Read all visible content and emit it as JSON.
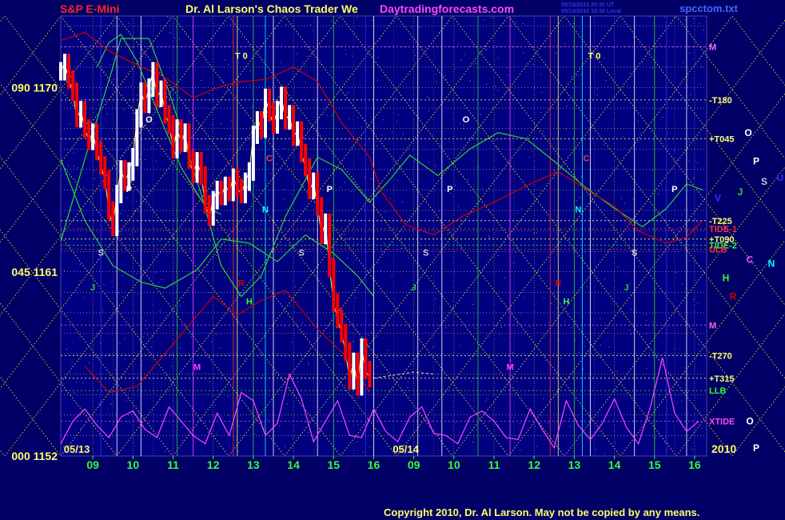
{
  "header": {
    "symbol": "S&P E-Mini",
    "title": "Dr. Al Larson's Chaos Trader We",
    "site": "Daytradingforecasts.com",
    "stamp_line1": "05/13/2010 20:30 UT",
    "stamp_line2": "05/13/2010 15:30 Local",
    "file": "spcctom.txt"
  },
  "footer": {
    "copyright": "Copyright 2010, Dr. Al Larson. May not be copied by any means.",
    "year": "2010"
  },
  "colors": {
    "background": "#000066",
    "grid_yellow": "#ffff66",
    "price_red": "#ff0000",
    "price_white": "#ffffff",
    "green_flux": "#33cc33",
    "red_flux": "#cc0000",
    "xtide": "#ff44ff",
    "fib_line": "#dddd22"
  },
  "chart_data": {
    "type": "line",
    "title": "S&P E-Mini",
    "xlabel": "",
    "ylabel": "",
    "ylim": [
      1152,
      1173.5
    ],
    "y_ticks": [
      {
        "value": 1170,
        "label": "090  1170"
      },
      {
        "value": 1161,
        "label": "045  1161"
      },
      {
        "value": 1152,
        "label": "000  1152"
      }
    ],
    "day_labels": [
      "05/13",
      "05/14"
    ],
    "hour_ticks": [
      "09",
      "10",
      "11",
      "12",
      "13",
      "14",
      "15",
      "16",
      "09",
      "10",
      "11",
      "12",
      "13",
      "14",
      "15",
      "16"
    ],
    "x_range": [
      8.2,
      24.3
    ],
    "price": {
      "name": "S&P E-Mini",
      "x": [
        8.2,
        8.3,
        8.4,
        8.5,
        8.6,
        8.7,
        8.8,
        8.9,
        9.0,
        9.1,
        9.2,
        9.3,
        9.4,
        9.5,
        9.6,
        9.7,
        9.8,
        9.9,
        10.0,
        10.1,
        10.2,
        10.3,
        10.4,
        10.5,
        10.6,
        10.7,
        10.8,
        10.9,
        11.0,
        11.1,
        11.2,
        11.3,
        11.4,
        11.5,
        11.6,
        11.7,
        11.8,
        11.9,
        12.0,
        12.1,
        12.2,
        12.3,
        12.4,
        12.5,
        12.6,
        12.7,
        12.8,
        12.9,
        13.0,
        13.1,
        13.2,
        13.3,
        13.4,
        13.5,
        13.6,
        13.7,
        13.8,
        13.9,
        14.0,
        14.1,
        14.2,
        14.3,
        14.4,
        14.5,
        14.6,
        14.7,
        14.8,
        14.9,
        15.0,
        15.1,
        15.2,
        15.3,
        15.4,
        15.5,
        15.6,
        15.7,
        15.8,
        15.9
      ],
      "close": [
        1170.8,
        1171.2,
        1170.4,
        1169.8,
        1168.5,
        1168.9,
        1168.0,
        1167.4,
        1167.8,
        1166.9,
        1166.2,
        1165.5,
        1164.0,
        1163.2,
        1164.8,
        1166.0,
        1165.4,
        1165.9,
        1166.6,
        1168.5,
        1169.8,
        1169.2,
        1170.0,
        1170.8,
        1169.5,
        1169.9,
        1168.7,
        1168.2,
        1167.0,
        1168.0,
        1167.3,
        1167.8,
        1166.5,
        1165.8,
        1166.4,
        1165.7,
        1164.3,
        1163.7,
        1164.5,
        1165.0,
        1164.7,
        1165.2,
        1164.9,
        1165.6,
        1165.1,
        1164.8,
        1165.4,
        1165.9,
        1167.7,
        1168.4,
        1168.0,
        1169.5,
        1168.8,
        1168.2,
        1168.9,
        1169.6,
        1168.4,
        1168.7,
        1167.6,
        1167.9,
        1166.8,
        1166.1,
        1165.0,
        1165.4,
        1164.2,
        1162.8,
        1163.4,
        1161.2,
        1159.5,
        1158.7,
        1158.0,
        1157.1,
        1155.7,
        1156.6,
        1155.4,
        1157.3,
        1156.2,
        1155.8
      ],
      "extension_x": [
        16.0,
        17.0,
        17.5
      ],
      "extension_close": [
        1155.8,
        1156.1,
        1156.0
      ]
    },
    "bands": [
      {
        "color": "green",
        "x": [
          8.2,
          8.8,
          9.5,
          9.7,
          10.4,
          10.9,
          11.7,
          12.2,
          12.7,
          13.2,
          13.8,
          14.6,
          15.2,
          15.9,
          16.4,
          16.9,
          17.6,
          18.4,
          19.1,
          19.8,
          20.5,
          21.3,
          22.0,
          22.7,
          23.3,
          23.8,
          24.2
        ],
        "values": [
          1162.5,
          1166.5,
          1171.0,
          1172.4,
          1172.4,
          1169.8,
          1164.8,
          1161.3,
          1159.8,
          1160.8,
          1163.7,
          1166.6,
          1166.0,
          1164.4,
          1165.5,
          1166.7,
          1165.7,
          1167.0,
          1167.8,
          1167.5,
          1166.4,
          1165.1,
          1164.1,
          1163.2,
          1164.1,
          1165.3,
          1165.0
        ]
      },
      {
        "color": "green",
        "x": [
          8.2,
          8.8,
          9.5,
          10.2,
          10.8,
          11.6,
          12.2,
          12.9,
          13.6,
          14.3,
          15.0,
          15.6,
          16.0
        ],
        "values": [
          1166.5,
          1163.5,
          1161.3,
          1160.5,
          1160.2,
          1161.1,
          1162.6,
          1162.4,
          1161.5,
          1162.8,
          1161.9,
          1160.8,
          1159.8
        ]
      },
      {
        "color": "green",
        "x": [
          9.1,
          9.4,
          9.7,
          10.1,
          10.6,
          11.2,
          11.8,
          12.2
        ],
        "values": [
          1171.0,
          1172.2,
          1172.6,
          1171.3,
          1168.9,
          1166.1,
          1164.2,
          1163.8
        ]
      },
      {
        "color": "red",
        "x": [
          8.2,
          8.8,
          9.4,
          10.0,
          10.8,
          11.5,
          12.1,
          12.7,
          13.3,
          14.0,
          14.6,
          15.2,
          15.9,
          16.2,
          16.8,
          17.5,
          18.2,
          19.0,
          19.8,
          20.6,
          21.4,
          22.0,
          22.6,
          23.3,
          23.8,
          24.2
        ],
        "values": [
          1172.3,
          1172.7,
          1171.8,
          1171.2,
          1170.5,
          1169.5,
          1170.0,
          1170.3,
          1170.4,
          1171.0,
          1170.3,
          1168.3,
          1166.6,
          1164.9,
          1163.3,
          1162.8,
          1163.7,
          1164.4,
          1165.2,
          1165.9,
          1164.9,
          1164.2,
          1163.0,
          1162.4,
          1162.7,
          1163.5
        ]
      },
      {
        "color": "red",
        "x": [
          8.8,
          9.4,
          10.1,
          10.8,
          11.4,
          12.0,
          12.6,
          13.2,
          13.8,
          14.6,
          15.3,
          15.9
        ],
        "values": [
          1156.4,
          1155.1,
          1155.4,
          1157.0,
          1158.4,
          1159.8,
          1158.9,
          1159.6,
          1160.1,
          1158.2,
          1156.9,
          1155.1
        ]
      }
    ],
    "xtide": {
      "name": "XTIDE",
      "x": [
        8.2,
        8.5,
        8.8,
        9.1,
        9.4,
        9.7,
        10.0,
        10.3,
        10.6,
        10.9,
        11.2,
        11.5,
        11.8,
        12.1,
        12.4,
        12.7,
        13.0,
        13.3,
        13.6,
        13.9,
        14.2,
        14.5,
        14.8,
        15.1,
        15.4,
        15.7,
        16.0,
        16.3,
        16.6,
        16.9,
        17.2,
        17.5,
        17.8,
        18.1,
        18.4,
        18.7,
        19.0,
        19.3,
        19.6,
        19.9,
        20.2,
        20.5,
        20.8,
        21.1,
        21.4,
        21.7,
        22.0,
        22.3,
        22.6,
        22.9,
        23.2,
        23.5,
        23.8,
        24.1
      ],
      "values": [
        1152.6,
        1153.7,
        1154.3,
        1153.5,
        1152.9,
        1153.9,
        1154.2,
        1153.3,
        1152.9,
        1154.4,
        1153.7,
        1153.0,
        1152.6,
        1154.1,
        1153.0,
        1155.1,
        1154.7,
        1153.0,
        1153.6,
        1156.0,
        1154.8,
        1152.7,
        1153.7,
        1154.7,
        1153.0,
        1152.9,
        1154.3,
        1153.2,
        1152.7,
        1153.9,
        1154.4,
        1153.1,
        1153.0,
        1152.6,
        1153.9,
        1154.2,
        1153.7,
        1152.9,
        1152.8,
        1154.3,
        1153.3,
        1152.4,
        1154.7,
        1153.5,
        1152.8,
        1153.6,
        1154.8,
        1153.4,
        1152.6,
        1154.4,
        1156.8,
        1154.1,
        1153.2,
        1153.7
      ]
    },
    "horizontal_levels": [
      {
        "label": "M",
        "value": 1172.0,
        "color": "#ff66ff"
      },
      {
        "label": "-T180",
        "value": 1169.4,
        "color": "#ffff66"
      },
      {
        "label": "+T045",
        "value": 1167.5,
        "color": "#ffff66"
      },
      {
        "label": "-T225",
        "value": 1163.5,
        "color": "#ffff66"
      },
      {
        "label": "+T090",
        "value": 1162.6,
        "color": "#ffff66"
      },
      {
        "label": "TIDE-1",
        "value": 1163.1,
        "color": "#ff3333"
      },
      {
        "label": "TIDE-2",
        "value": 1162.3,
        "color": "#33ff33"
      },
      {
        "label": "ULB",
        "value": 1162.1,
        "color": "#ff3333"
      },
      {
        "label": "M",
        "value": 1158.4,
        "color": "#ff66ff"
      },
      {
        "label": "-T270",
        "value": 1156.9,
        "color": "#ffff66"
      },
      {
        "label": "+T315",
        "value": 1155.8,
        "color": "#ffff66"
      },
      {
        "label": "LLB",
        "value": 1155.2,
        "color": "#33ff33"
      },
      {
        "label": "XTIDE",
        "value": 1153.7,
        "color": "#ff44ff"
      }
    ],
    "planet_labels": [
      {
        "label": "O",
        "color": "#ffffff",
        "value": 1167.8
      },
      {
        "label": "P",
        "color": "#ffffff",
        "value": 1166.4
      },
      {
        "label": "U",
        "color": "#3333ff",
        "value": 1165.6
      },
      {
        "label": "J",
        "color": "#33cc33",
        "value": 1164.9
      },
      {
        "label": "S",
        "color": "#cccccc",
        "value": 1165.4
      },
      {
        "label": "V",
        "color": "#3333ff",
        "value": 1164.6
      },
      {
        "label": "C",
        "color": "#ff44ff",
        "value": 1161.6
      },
      {
        "label": "N",
        "color": "#00ffff",
        "value": 1161.4
      },
      {
        "label": "H",
        "color": "#33ff33",
        "value": 1160.7
      },
      {
        "label": "R",
        "color": "#cc0000",
        "value": 1159.8
      },
      {
        "label": "O",
        "color": "#ffffff",
        "value": 1153.7
      },
      {
        "label": "P",
        "color": "#ffffff",
        "value": 1152.4
      }
    ],
    "event_labels": [
      {
        "label": "T 0",
        "color": "#ffff66",
        "x": 12.7,
        "value": 1171.4
      },
      {
        "label": "T 0",
        "color": "#ffff66",
        "x": 21.5,
        "value": 1171.4
      },
      {
        "label": "O",
        "color": "#ffffff",
        "x": 10.4,
        "value": 1168.3
      },
      {
        "label": "O",
        "color": "#ffffff",
        "x": 18.3,
        "value": 1168.3
      },
      {
        "label": "P",
        "color": "#ffffff",
        "x": 9.9,
        "value": 1164.9
      },
      {
        "label": "P",
        "color": "#ffffff",
        "x": 14.9,
        "value": 1164.9
      },
      {
        "label": "P",
        "color": "#ffffff",
        "x": 17.9,
        "value": 1164.9
      },
      {
        "label": "P",
        "color": "#ffffff",
        "x": 23.5,
        "value": 1164.9
      },
      {
        "label": "C",
        "color": "#ff3333",
        "x": 13.4,
        "value": 1166.4
      },
      {
        "label": "C",
        "color": "#ff3333",
        "x": 21.3,
        "value": 1166.4
      },
      {
        "label": "N",
        "color": "#00ffff",
        "x": 13.3,
        "value": 1163.9
      },
      {
        "label": "N",
        "color": "#00ffff",
        "x": 21.1,
        "value": 1163.9
      },
      {
        "label": "S",
        "color": "#cccccc",
        "x": 9.2,
        "value": 1161.8
      },
      {
        "label": "S",
        "color": "#cccccc",
        "x": 14.2,
        "value": 1161.8
      },
      {
        "label": "S",
        "color": "#cccccc",
        "x": 17.3,
        "value": 1161.8
      },
      {
        "label": "S",
        "color": "#cccccc",
        "x": 22.5,
        "value": 1161.8
      },
      {
        "label": "J",
        "color": "#33cc33",
        "x": 9.0,
        "value": 1160.1
      },
      {
        "label": "J",
        "color": "#33cc33",
        "x": 17.0,
        "value": 1160.1
      },
      {
        "label": "J",
        "color": "#33cc33",
        "x": 22.3,
        "value": 1160.1
      },
      {
        "label": "H",
        "color": "#33ff33",
        "x": 12.9,
        "value": 1159.4
      },
      {
        "label": "H",
        "color": "#33ff33",
        "x": 20.8,
        "value": 1159.4
      },
      {
        "label": "R",
        "color": "#cc0000",
        "x": 12.7,
        "value": 1160.3
      },
      {
        "label": "R",
        "color": "#cc0000",
        "x": 20.6,
        "value": 1160.3
      },
      {
        "label": "M",
        "color": "#ff44ff",
        "x": 11.6,
        "value": 1156.2
      },
      {
        "label": "M",
        "color": "#ff44ff",
        "x": 19.4,
        "value": 1156.2
      }
    ],
    "vertical_events": [
      {
        "x": 9.2,
        "color": "#3333ff"
      },
      {
        "x": 9.6,
        "color": "#ffffff"
      },
      {
        "x": 10.2,
        "color": "#ffffff"
      },
      {
        "x": 11.1,
        "color": "#33cc33"
      },
      {
        "x": 11.5,
        "color": "#ff44ff"
      },
      {
        "x": 12.5,
        "color": "#ff3333"
      },
      {
        "x": 12.6,
        "color": "#ffff66"
      },
      {
        "x": 13.0,
        "color": "#33cc33"
      },
      {
        "x": 13.3,
        "color": "#00ffff"
      },
      {
        "x": 13.5,
        "color": "#ffffff"
      },
      {
        "x": 14.6,
        "color": "#ffffff"
      },
      {
        "x": 15.0,
        "color": "#33cc33"
      },
      {
        "x": 15.8,
        "color": "#3333ff"
      },
      {
        "x": 16.0,
        "color": "#ffffff"
      },
      {
        "x": 17.1,
        "color": "#ffffff"
      },
      {
        "x": 17.7,
        "color": "#ffffff"
      },
      {
        "x": 18.6,
        "color": "#33cc33"
      },
      {
        "x": 19.4,
        "color": "#ff44ff"
      },
      {
        "x": 20.4,
        "color": "#ff3333"
      },
      {
        "x": 20.6,
        "color": "#ffff66"
      },
      {
        "x": 21.0,
        "color": "#33cc33"
      },
      {
        "x": 21.2,
        "color": "#00ffff"
      },
      {
        "x": 21.4,
        "color": "#ffffff"
      },
      {
        "x": 22.5,
        "color": "#ffffff"
      },
      {
        "x": 23.0,
        "color": "#33cc33"
      },
      {
        "x": 23.3,
        "color": "#3333ff"
      },
      {
        "x": 23.8,
        "color": "#ffffff"
      }
    ]
  }
}
